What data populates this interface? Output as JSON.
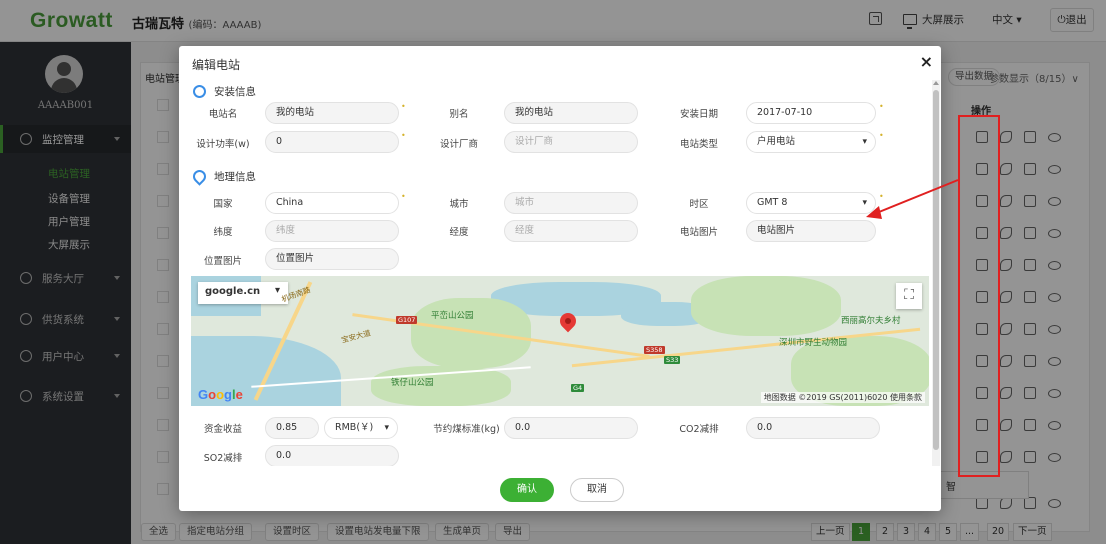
{
  "app": {
    "logo": "Growatt",
    "station_name": "古瑞瓦特",
    "station_code": "(编码：AAAAB)",
    "top_actions": {
      "large_screen": "大屏展示",
      "language": "中文 ▾",
      "logout": "退出"
    }
  },
  "sidebar": {
    "username": "AAAAB001",
    "menu": [
      {
        "label": "监控管理",
        "icon": "monitor-icon"
      },
      {
        "label": "服务大厅",
        "icon": "heart-icon"
      },
      {
        "label": "供货系统",
        "icon": "box-icon"
      },
      {
        "label": "用户中心",
        "icon": "users-icon"
      },
      {
        "label": "系统设置",
        "icon": "gear-icon"
      }
    ],
    "submenu": [
      "电站管理",
      "设备管理",
      "用户管理",
      "大屏展示"
    ]
  },
  "background": {
    "tab": "电站管理",
    "export_data": "导出数据",
    "param_show": "参数显示（8/15）∨",
    "ops_header": "操作",
    "toast": "智",
    "bottom_buttons": [
      "全选",
      "指定电站分组",
      "设置时区",
      "设置电站发电量下限",
      "生成单页",
      "导出"
    ],
    "pagination": [
      "上一页",
      "1",
      "2",
      "3",
      "4",
      "5",
      "...",
      "20",
      "下一页"
    ]
  },
  "modal": {
    "title": "编辑电站",
    "close": "×",
    "section_install": "安装信息",
    "section_geo": "地理信息",
    "fields": {
      "station_name": {
        "label": "电站名",
        "value": "我的电站"
      },
      "alias": {
        "label": "别名",
        "value": "我的电站"
      },
      "install_date": {
        "label": "安装日期",
        "value": "2017-07-10"
      },
      "design_power": {
        "label": "设计功率(w)",
        "value": "0"
      },
      "design_maker": {
        "label": "设计厂商",
        "placeholder": "设计厂商"
      },
      "station_type": {
        "label": "电站类型",
        "value": "户用电站"
      },
      "country": {
        "label": "国家",
        "value": "China"
      },
      "city": {
        "label": "城市",
        "placeholder": "城市"
      },
      "timezone": {
        "label": "时区",
        "value": "GMT 8"
      },
      "latitude": {
        "label": "纬度",
        "placeholder": "纬度"
      },
      "longitude": {
        "label": "经度",
        "placeholder": "经度"
      },
      "station_image": {
        "label": "电站图片",
        "value": "电站图片"
      },
      "location_image": {
        "label": "位置图片",
        "value": "位置图片"
      },
      "income": {
        "label": "资金收益",
        "value": "0.85",
        "currency": "RMB(￥)"
      },
      "coal_saving": {
        "label": "节约煤标准(kg)",
        "value": "0.0"
      },
      "co2": {
        "label": "CO2减排",
        "value": "0.0"
      },
      "so2": {
        "label": "SO2减排",
        "value": "0.0"
      }
    },
    "map": {
      "provider": "google.cn",
      "labels": {
        "park1": "平峦山公园",
        "park2": "铁仔山公园",
        "village": "西丽高尔夫乡村",
        "zoo": "深圳市野生动物园",
        "road1": "机场南路",
        "road2": "宝安大道"
      },
      "road_badges": [
        "G107",
        "S358",
        "G4",
        "S33"
      ],
      "attribution": "地图数据 ©2019 GS(2011)6020  使用条款",
      "google_letters": [
        "G",
        "o",
        "o",
        "g",
        "l",
        "e"
      ]
    },
    "buttons": {
      "ok": "确认",
      "cancel": "取消"
    }
  },
  "colors": {
    "brand_green": "#4aa63c",
    "primary_button": "#3cb034",
    "annotation_red": "#e02020",
    "section_icon": "#3a8ee6"
  }
}
